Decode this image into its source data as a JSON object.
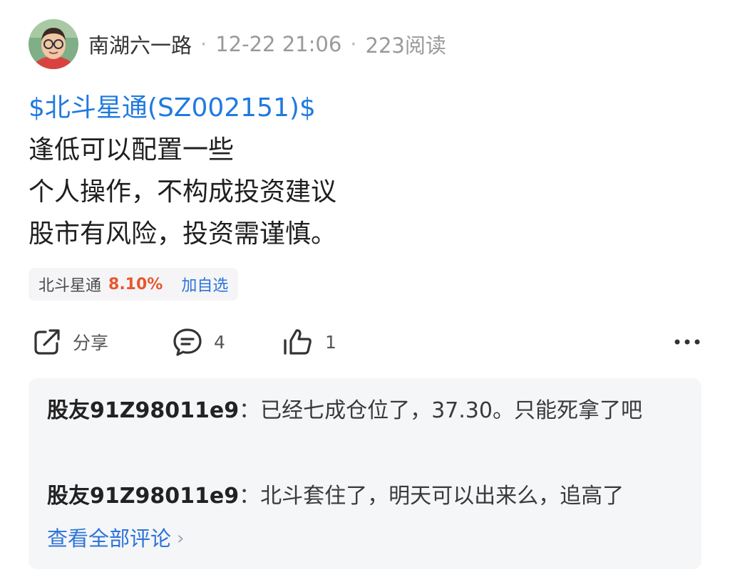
{
  "author": {
    "name": "南湖六一路",
    "time": "12-22 21:06",
    "views": "223阅读",
    "separator": "·"
  },
  "post": {
    "stock_tag": "$北斗星通(SZ002151)$",
    "lines": [
      "逢低可以配置一些",
      "个人操作，不构成投资建议",
      "股市有风险，投资需谨慎。"
    ]
  },
  "stock_chip": {
    "name": "北斗星通",
    "change": "8.10%",
    "add_label": "加自选",
    "change_color": "#e8572d"
  },
  "actions": {
    "share_label": "分享",
    "comment_count": "4",
    "like_count": "1",
    "more_label": "···"
  },
  "comments": [
    {
      "user": "股友91Z98011e9",
      "separator": "：",
      "text": "已经七成仓位了，37.30。只能死拿了吧"
    },
    {
      "user": "股友91Z98011e9",
      "separator": "：",
      "text": "北斗套住了，明天可以出来么，追高了"
    }
  ],
  "view_all_label": "查看全部评论",
  "view_all_chevron": "›",
  "icons": {
    "avatar": "avatar-image",
    "share": "share-icon",
    "comment": "comment-icon",
    "like": "thumbs-up-icon",
    "more": "more-icon"
  }
}
